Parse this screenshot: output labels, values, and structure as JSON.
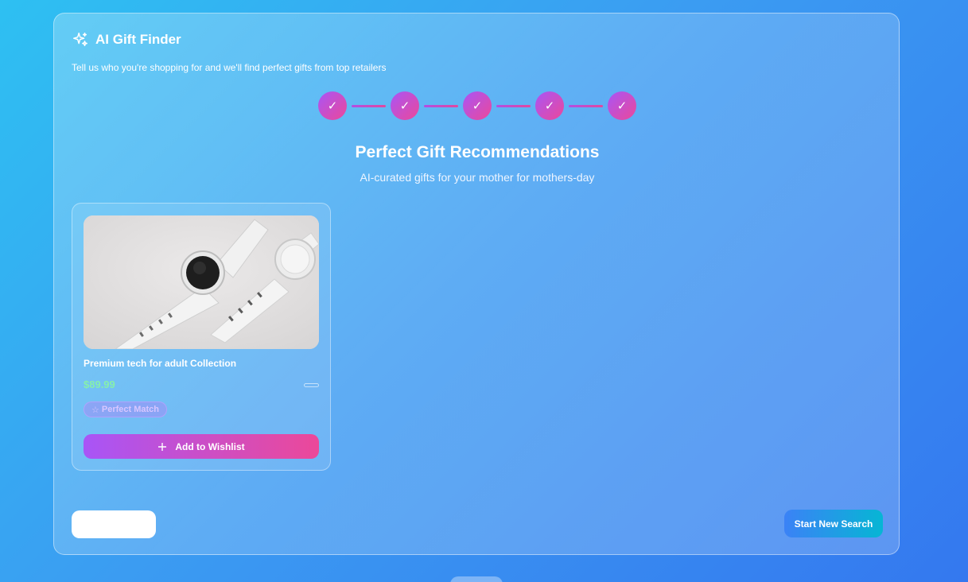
{
  "app": {
    "title": "AI Gift Finder",
    "icon": "sparkles-icon",
    "subtitle": "Tell us who you're shopping for and we'll find perfect gifts from top retailers"
  },
  "stepper": {
    "steps": [
      {
        "state": "complete",
        "glyph": "✓"
      },
      {
        "state": "complete",
        "glyph": "✓"
      },
      {
        "state": "complete",
        "glyph": "✓"
      },
      {
        "state": "complete",
        "glyph": "✓"
      },
      {
        "state": "complete",
        "glyph": "✓"
      }
    ]
  },
  "results": {
    "title": "Perfect Gift Recommendations",
    "subtitle": "AI-curated gifts for your mother for mothers-day"
  },
  "products": [
    {
      "name": "Premium tech for adult Collection",
      "price": "$89.99",
      "badge": "Perfect Match",
      "badge_icon": "star-icon",
      "action_label": "Add to Wishlist",
      "action_icon": "plus-icon",
      "image": "smartwatch-photo"
    }
  ],
  "footer": {
    "back_label": "",
    "new_search_label": "Start New Search"
  },
  "colors": {
    "accent_gradient_start": "#a855f7",
    "accent_gradient_end": "#ec4899",
    "price": "#86efac",
    "search_gradient_start": "#3b82f6",
    "search_gradient_end": "#06b6d4"
  }
}
